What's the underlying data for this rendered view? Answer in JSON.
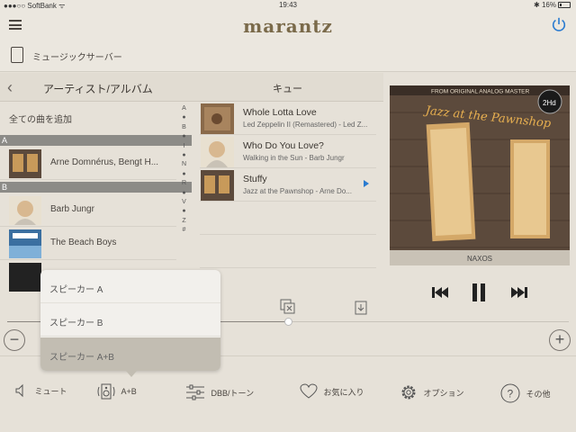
{
  "status_bar": {
    "carrier": "SoftBank",
    "time": "19:43",
    "battery": "16%"
  },
  "header": {
    "logo": "marantz"
  },
  "server": {
    "label": "ミュージックサーバー"
  },
  "browse": {
    "title": "アーティスト/アルバム",
    "add_all": "全ての曲を追加",
    "sections": [
      {
        "letter": "A",
        "items": [
          "Arne Domnérus, Bengt H..."
        ]
      },
      {
        "letter": "B",
        "items": [
          "Barb Jungr",
          "The Beach Boys"
        ]
      }
    ],
    "index": [
      "A",
      "●",
      "B",
      "●",
      "I",
      "●",
      "N",
      "●",
      "R",
      "●",
      "V",
      "●",
      "Z",
      "#"
    ]
  },
  "queue": {
    "title": "キュー",
    "tracks": [
      {
        "title": "Whole Lotta Love",
        "subtitle": "Led Zeppelin II (Remastered) - Led Z..."
      },
      {
        "title": "Who Do You Love?",
        "subtitle": "Walking in the Sun - Barb Jungr"
      },
      {
        "title": "Stuffy",
        "subtitle": "Jazz at the Pawnshop - Arne Do..."
      }
    ]
  },
  "album_art": {
    "banner": "FROM ORIGINAL ANALOG MASTER",
    "title": "Jazz at the Pawnshop",
    "badge": "2Hd",
    "label": "NAXOS"
  },
  "speaker_popup": {
    "options": [
      "スピーカー A",
      "スピーカー B",
      "スピーカー A+B"
    ],
    "selected_index": 2
  },
  "toolbar": {
    "mute": "ミュート",
    "speaker": "A+B",
    "dbb_tone": "DBB/トーン",
    "favorite": "お気に入り",
    "option": "オプション",
    "other": "その他"
  },
  "playback": {
    "progress_fraction": 0.5
  },
  "colors": {
    "accent": "#2a7bd0",
    "section_bar": "#8c8b87",
    "logo": "#7a6a4a"
  }
}
